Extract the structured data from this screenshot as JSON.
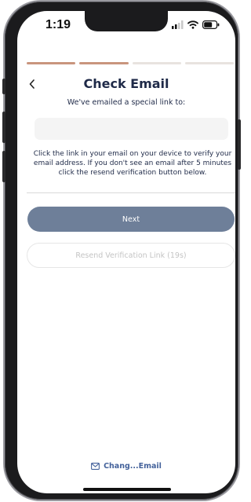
{
  "status_bar": {
    "time": "1:19",
    "icons": [
      "signal-icon",
      "wifi-icon",
      "battery-icon"
    ]
  },
  "progress": {
    "total_steps": 4,
    "completed_steps": 2,
    "active_color": "#c9957e",
    "inactive_color": "#e8e3df"
  },
  "header": {
    "back_icon": "chevron-left-icon",
    "title": "Check Email",
    "subtitle": "We've emailed a special link to:"
  },
  "email_display": {
    "value": ""
  },
  "instructions": "Click the link in your email on your device to verify your email address. If you don't see an email after 5 minutes click the resend verification button below.",
  "buttons": {
    "next_label": "Next",
    "resend_label": "Resend Verification Link (19s)"
  },
  "footer": {
    "change_email_icon": "mail-icon",
    "change_email_label": "Chang...Email"
  },
  "colors": {
    "primary_button": "#6e7f99",
    "text_dark": "#1f2a48",
    "link": "#44629b"
  }
}
